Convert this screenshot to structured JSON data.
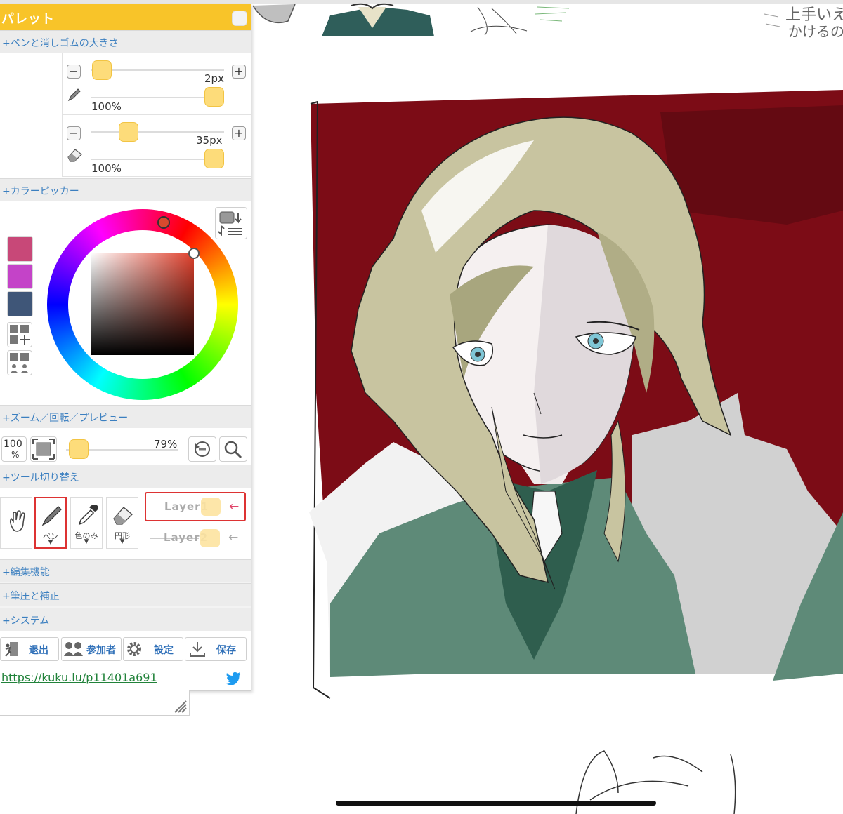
{
  "palette": {
    "title": "パレット",
    "sections": {
      "pen_eraser": "+ペンと消しゴムの大きさ",
      "color_picker": "+カラーピッカー",
      "zoom": "+ズーム／回転／プレビュー",
      "tools": "+ツール切り替え",
      "edit": "+編集機能",
      "pressure": "+筆圧と補正",
      "system": "+システム"
    },
    "pen": {
      "size": "2px",
      "opacity": "100%"
    },
    "eraser": {
      "size": "35px",
      "opacity": "100%"
    },
    "swatches": [
      "#c84878",
      "#c443c8",
      "#3f5678"
    ],
    "picker": {
      "hue_color": "#e0402c"
    },
    "zoom": {
      "reset_label": "100",
      "reset_unit": "%",
      "value": "79%",
      "level": 0.79
    },
    "tools": [
      {
        "name": "hand",
        "label": ""
      },
      {
        "name": "pen",
        "label": "ペン",
        "selected": true
      },
      {
        "name": "eyedropper",
        "label": "色のみ"
      },
      {
        "name": "ellipse",
        "label": "円形"
      }
    ],
    "layers": [
      {
        "label": "Layer1",
        "active": true
      },
      {
        "label": "Layer2",
        "active": false
      }
    ],
    "bottom_buttons": {
      "exit": "退出",
      "members": "参加者",
      "settings": "設定",
      "save": "保存"
    },
    "url": "https://kuku.lu/p11401a691"
  },
  "canvas": {
    "note_line1": "上手いえ",
    "note_line2": "かけるの"
  }
}
